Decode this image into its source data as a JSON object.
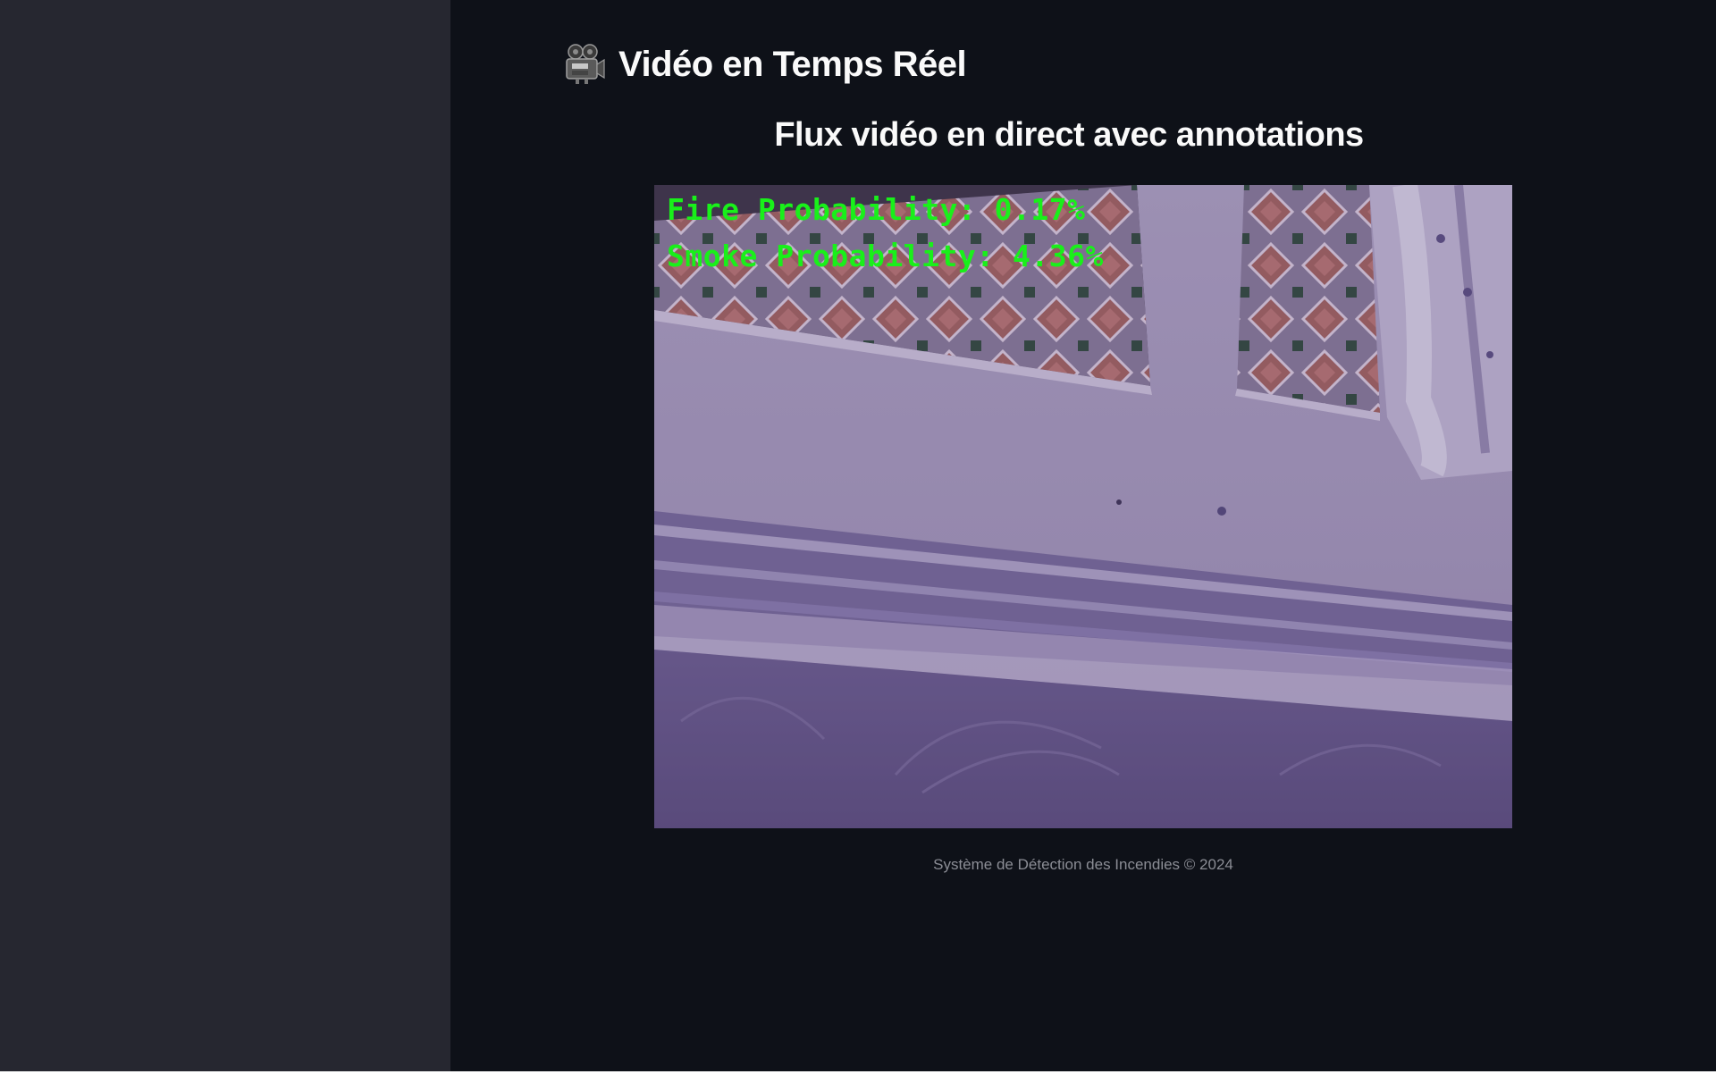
{
  "header": {
    "title": "Vidéo en Temps Réel",
    "title_icon": "movie-camera-icon"
  },
  "main": {
    "subtitle": "Flux vidéo en direct avec annotations",
    "video": {
      "overlay": {
        "fire_text": "Fire Probability: 0.17%",
        "smoke_text": "Smoke Probability: 4.36%",
        "fire_probability_percent": 0.17,
        "smoke_probability_percent": 4.36,
        "text_color": "#19f01a"
      }
    },
    "footer": "Système de Détection des Incendies © 2024"
  },
  "colors": {
    "sidebar_bg": "#262730",
    "main_bg": "#0e1118",
    "text": "#fafafa",
    "footer_text": "#8b8d95"
  }
}
